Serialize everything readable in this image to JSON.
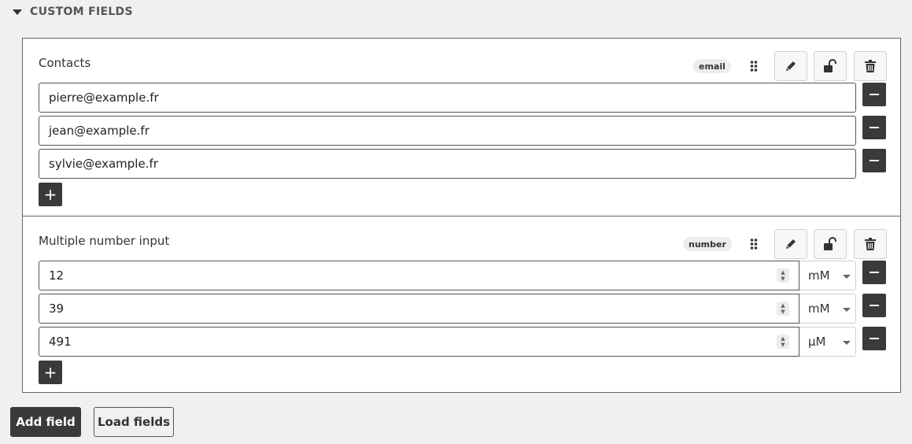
{
  "section": {
    "title": "CUSTOM FIELDS"
  },
  "fields": [
    {
      "title": "Contacts",
      "type": "email",
      "values": [
        "pierre@example.fr",
        "jean@example.fr",
        "sylvie@example.fr"
      ]
    },
    {
      "title": "Multiple number input",
      "type": "number",
      "values": [
        {
          "value": "12",
          "unit": "mM"
        },
        {
          "value": "39",
          "unit": "mM"
        },
        {
          "value": "491",
          "unit": "µM"
        }
      ]
    }
  ],
  "buttons": {
    "add_field": "Add field",
    "load_fields": "Load fields"
  },
  "icons": {
    "collapse": "caret-down-icon",
    "drag": "drag-handle-icon",
    "edit": "pencil-icon",
    "lock": "unlock-icon",
    "delete": "trash-icon",
    "remove_value": "minus-icon",
    "add_value": "plus-icon"
  }
}
